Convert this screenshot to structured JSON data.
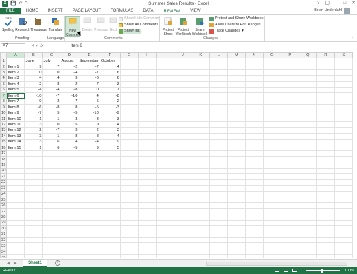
{
  "window": {
    "title": "Summer Sales Results - Excel",
    "logo": "X",
    "user": "Brian Underdahl"
  },
  "qat": {
    "save_icon": "save-icon",
    "undo_icon": "undo-icon",
    "redo_icon": "redo-icon"
  },
  "tabs": [
    "FILE",
    "HOME",
    "INSERT",
    "PAGE LAYOUT",
    "FORMULAS",
    "DATA",
    "REVIEW",
    "VIEW"
  ],
  "active_tab": "REVIEW",
  "ribbon": {
    "proofing": {
      "spelling": "Spelling",
      "research": "Research",
      "thesaurus": "Thesaurus",
      "label": "Proofing",
      "abc": "ABC"
    },
    "language": {
      "translate": "Translate",
      "label": "Language"
    },
    "comments": {
      "new_comment_1": "New",
      "new_comment_2": "Comment",
      "delete": "Delete",
      "previous": "Previous",
      "next": "Next",
      "show_hide": "Show/Hide Comment",
      "show_all": "Show All Comments",
      "show_ink": "Show Ink",
      "label": "Comments"
    },
    "changes": {
      "protect_sheet_1": "Protect",
      "protect_sheet_2": "Sheet",
      "protect_wb_1": "Protect",
      "protect_wb_2": "Workbook",
      "share_wb_1": "Share",
      "share_wb_2": "Workbook",
      "protect_share": "Protect and Share Workbook",
      "allow_users": "Allow Users to Edit Ranges",
      "track_changes": "Track Changes",
      "label": "Changes"
    }
  },
  "formula_bar": {
    "name_box": "A7",
    "fx": "fx",
    "value": "Item 6"
  },
  "columns": [
    "A",
    "B",
    "C",
    "D",
    "E",
    "F",
    "G",
    "H",
    "I",
    "J",
    "K",
    "L",
    "M",
    "N",
    "O",
    "P",
    "Q",
    "R",
    "S"
  ],
  "selected_cell": "A7",
  "header_row": [
    "",
    "June",
    "July",
    "August",
    "September",
    "October"
  ],
  "rows": [
    [
      "Item 1",
      9,
      7,
      -2,
      -7,
      4
    ],
    [
      "Item 2",
      10,
      0,
      -4,
      -7,
      6
    ],
    [
      "Item 3",
      4,
      4,
      3,
      -6,
      6
    ],
    [
      "Item 4",
      -2,
      -8,
      2,
      7,
      -3
    ],
    [
      "Item 5",
      -4,
      -4,
      -8,
      0,
      7
    ],
    [
      "Item 6",
      -10,
      -7,
      -10,
      4,
      -8
    ],
    [
      "Item 7",
      9,
      2,
      -7,
      6,
      2
    ],
    [
      "Item 8",
      -6,
      -8,
      8,
      -5,
      -3
    ],
    [
      "Item 9",
      -7,
      5,
      -5,
      -10,
      -9
    ],
    [
      "Item 10",
      1,
      -1,
      -3,
      -3,
      -3
    ],
    [
      "Item 11",
      3,
      0,
      5,
      9,
      4
    ],
    [
      "Item 12",
      2,
      -7,
      3,
      2,
      3
    ],
    [
      "Item 13",
      -3,
      1,
      8,
      -8,
      4
    ],
    [
      "Item 14",
      3,
      6,
      4,
      -4,
      9
    ],
    [
      "Item 15",
      1,
      6,
      -5,
      9,
      5
    ]
  ],
  "visible_row_count": 35,
  "sheet_tabs": [
    "Sheet1"
  ],
  "status": {
    "ready": "READY",
    "zoom": "100%"
  },
  "colors": {
    "accent": "#217346"
  }
}
